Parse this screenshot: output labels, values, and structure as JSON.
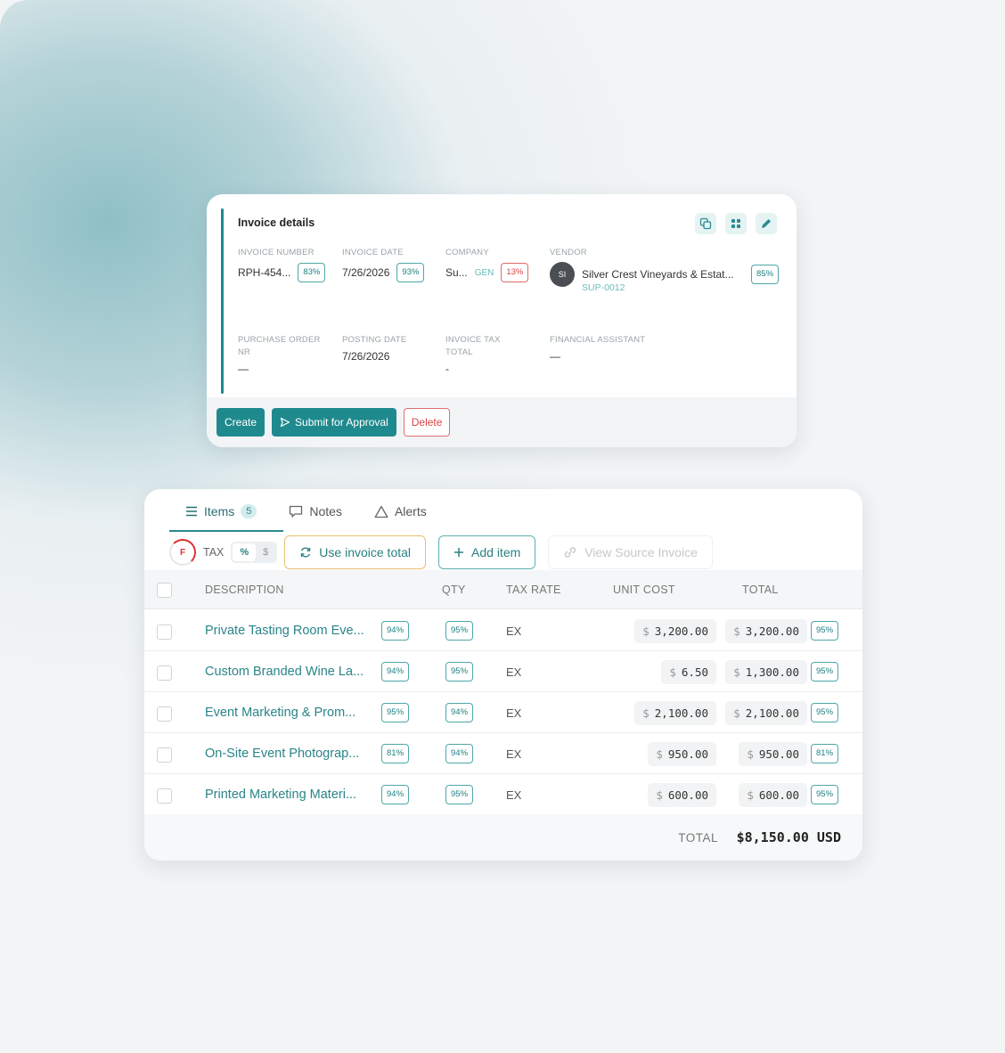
{
  "invoice_card": {
    "title": "Invoice details",
    "fields": {
      "invoice_number": {
        "label": "INVOICE NUMBER",
        "value": "RPH-454...",
        "confidence": "83%"
      },
      "invoice_date": {
        "label": "INVOICE DATE",
        "value": "7/26/2026",
        "confidence": "93%"
      },
      "company": {
        "label": "COMPANY",
        "value": "Su...",
        "tag": "GEN",
        "confidence": "13%"
      },
      "vendor": {
        "label": "VENDOR",
        "avatar": "SI",
        "value": "Silver Crest Vineyards & Estat...",
        "code": "SUP-0012",
        "confidence": "85%"
      },
      "purchase_order": {
        "label_line1": "PURCHASE ORDER",
        "label_line2": "NR",
        "value": "—"
      },
      "posting_date": {
        "label": "POSTING DATE",
        "value": "7/26/2026"
      },
      "invoice_tax_total": {
        "label_line1": "INVOICE TAX",
        "label_line2": "TOTAL",
        "value": "-"
      },
      "financial_assistant": {
        "label": "FINANCIAL ASSISTANT",
        "value": "—"
      }
    },
    "buttons": {
      "create": "Create",
      "submit": "Submit for Approval",
      "delete": "Delete"
    },
    "icons": [
      "copy-icon",
      "grid-icon",
      "edit-icon"
    ]
  },
  "items_card": {
    "tabs": [
      {
        "label": "Items",
        "count": "5",
        "icon": "list-icon"
      },
      {
        "label": "Notes",
        "icon": "comment-icon"
      },
      {
        "label": "Alerts",
        "icon": "warning-icon"
      }
    ],
    "toolbar": {
      "grade": "F",
      "tax_label": "TAX",
      "seg_percent": "%",
      "seg_dollar": "$",
      "use_invoice_total": "Use invoice total",
      "add_item": "Add item",
      "view_source": "View Source Invoice"
    },
    "columns": [
      "DESCRIPTION",
      "QTY",
      "TAX RATE",
      "UNIT COST",
      "TOTAL"
    ],
    "rows": [
      {
        "description": "Private Tasting Room Eve...",
        "desc_conf": "94%",
        "qty_conf": "95%",
        "tax_rate": "EX",
        "currency": "$",
        "unit_cost": "3,200.00",
        "total": "3,200.00",
        "total_conf": "95%"
      },
      {
        "description": "Custom Branded Wine La...",
        "desc_conf": "94%",
        "qty_conf": "95%",
        "tax_rate": "EX",
        "currency": "$",
        "unit_cost": "6.50",
        "total": "1,300.00",
        "total_conf": "95%"
      },
      {
        "description": "Event Marketing & Prom...",
        "desc_conf": "95%",
        "qty_conf": "94%",
        "tax_rate": "EX",
        "currency": "$",
        "unit_cost": "2,100.00",
        "total": "2,100.00",
        "total_conf": "95%"
      },
      {
        "description": "On-Site Event Photograp...",
        "desc_conf": "81%",
        "qty_conf": "94%",
        "tax_rate": "EX",
        "currency": "$",
        "unit_cost": "950.00",
        "total": "950.00",
        "total_conf": "81%"
      },
      {
        "description": "Printed Marketing Materi...",
        "desc_conf": "94%",
        "qty_conf": "95%",
        "tax_rate": "EX",
        "currency": "$",
        "unit_cost": "600.00",
        "total": "600.00",
        "total_conf": "95%"
      }
    ],
    "grand_total": {
      "label": "TOTAL",
      "value": "$8,150.00 USD"
    }
  },
  "colors": {
    "accent": "#1f8a8e",
    "danger": "#dd4444",
    "warning_border": "#e8c070"
  }
}
